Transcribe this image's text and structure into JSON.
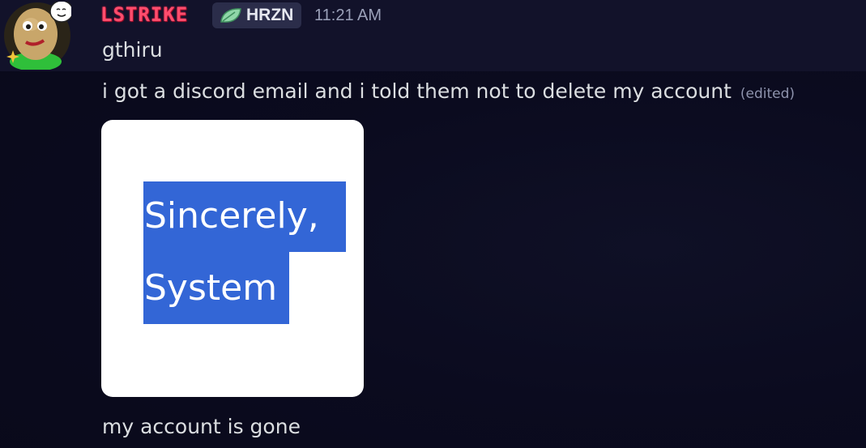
{
  "message": {
    "author": {
      "username": "LSTRIKE",
      "tag": {
        "icon": "leaf-icon",
        "label": "HRZN"
      },
      "avatar": "bald-character-avatar"
    },
    "timestamp": "11:21 AM",
    "lines": [
      "gthiru",
      "i got a discord email and i told them not to delete my account"
    ],
    "edited_label": "(edited)",
    "attachment": {
      "highlight_lines": [
        "Sincerely,",
        "System"
      ],
      "highlight_color": "#3366d6"
    },
    "followup": "my account is gone"
  },
  "colors": {
    "background": "#0b0b1f",
    "username": "#ff4d6d",
    "text": "#dbdee1",
    "muted": "#9aa0b8"
  }
}
